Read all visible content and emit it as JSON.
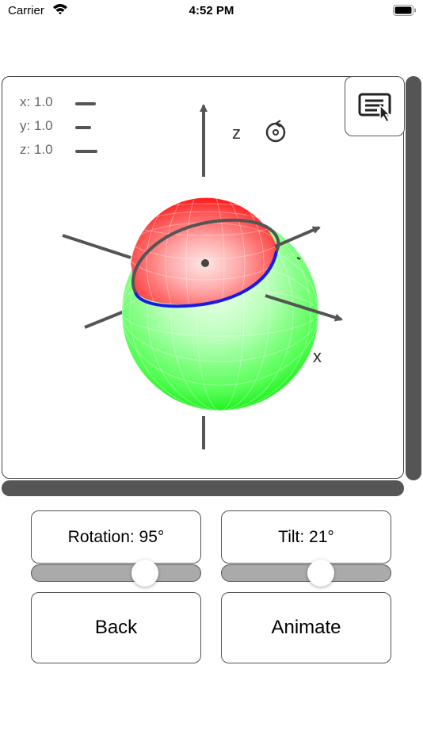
{
  "status_bar": {
    "carrier": "Carrier",
    "time": "4:52 PM"
  },
  "scale": [
    {
      "label": "x: 1.0"
    },
    {
      "label": "y: 1.0"
    },
    {
      "label": "z: 1.0"
    }
  ],
  "axes": {
    "z": "z",
    "x": "x"
  },
  "controls": {
    "rotation_label": "Rotation: 95°",
    "rotation_value": 0.7,
    "tilt_label": "Tilt: 21°",
    "tilt_value": 0.6,
    "back_label": "Back",
    "animate_label": "Animate"
  },
  "colors": {
    "red_sphere": "#ff3b3b",
    "green_sphere": "#2aff2a",
    "ellipse_front": "#1a1ae6",
    "axis": "#555555"
  },
  "icons": {
    "menu": "menu-pointer-icon",
    "reset": "reset-rotation-icon"
  }
}
